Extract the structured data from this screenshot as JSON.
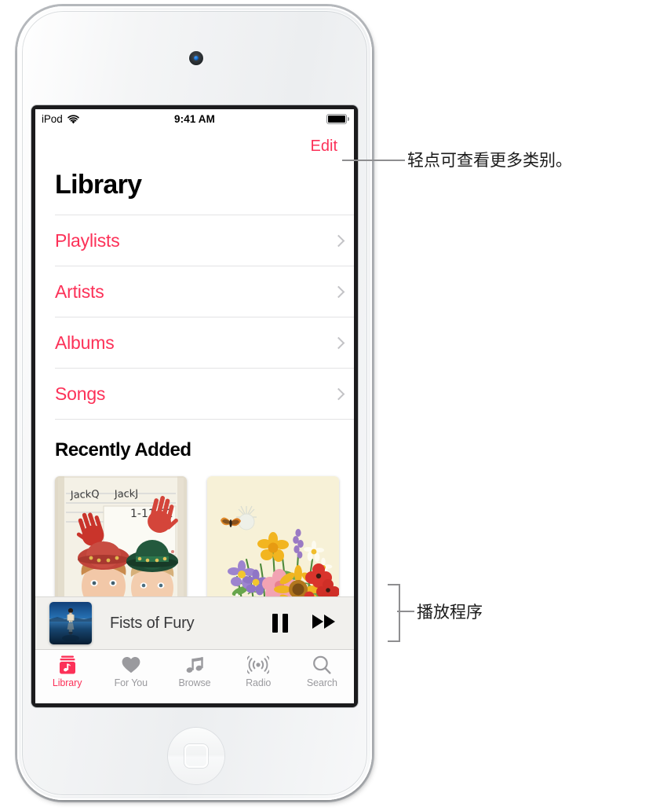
{
  "device": {
    "name": "iPod touch",
    "camera_icon": "front-camera",
    "home_button_icon": "home-square-icon"
  },
  "statusbar": {
    "carrier": "iPod",
    "wifi_icon": "wifi-icon",
    "time": "9:41 AM",
    "battery_icon": "battery-full-icon"
  },
  "screen": {
    "edit_label": "Edit",
    "page_title": "Library",
    "library_items": [
      {
        "label": "Playlists",
        "chevron_icon": "chevron-right-icon"
      },
      {
        "label": "Artists",
        "chevron_icon": "chevron-right-icon"
      },
      {
        "label": "Albums",
        "chevron_icon": "chevron-right-icon"
      },
      {
        "label": "Songs",
        "chevron_icon": "chevron-right-icon"
      }
    ],
    "section_title": "Recently Added",
    "artworks": [
      {
        "name": "album-art-handprints",
        "description": "Scrapbook photo with red handprints, two children in hats",
        "caption_line1": "JackQ  JackJ",
        "caption_line2": "1-11-02"
      },
      {
        "name": "album-art-wildflowers",
        "description": "Cream background with illustrated wildflowers and butterfly"
      }
    ]
  },
  "miniplayer": {
    "artwork_name": "now-playing-artwork",
    "track_title": "Fists of Fury",
    "pause_icon": "pause-icon",
    "next_icon": "fast-forward-icon"
  },
  "tabbar": {
    "tabs": [
      {
        "label": "Library",
        "icon": "library-stack-icon",
        "active": true
      },
      {
        "label": "For You",
        "icon": "heart-icon",
        "active": false
      },
      {
        "label": "Browse",
        "icon": "music-note-icon",
        "active": false
      },
      {
        "label": "Radio",
        "icon": "radio-broadcast-icon",
        "active": false
      },
      {
        "label": "Search",
        "icon": "search-icon",
        "active": false
      }
    ]
  },
  "annotations": [
    {
      "text": "轻点可查看更多类别。",
      "target": "edit-button",
      "leader": "line"
    },
    {
      "text": "播放程序",
      "target": "miniplayer",
      "leader": "bracket"
    }
  ],
  "colors": {
    "accent_pink": "#fc3158",
    "inactive_gray": "#9a9a9e",
    "chevron_gray": "#c3c3c6",
    "miniplayer_bg": "#f1f0ed",
    "annotation_line": "#8e8e90"
  }
}
